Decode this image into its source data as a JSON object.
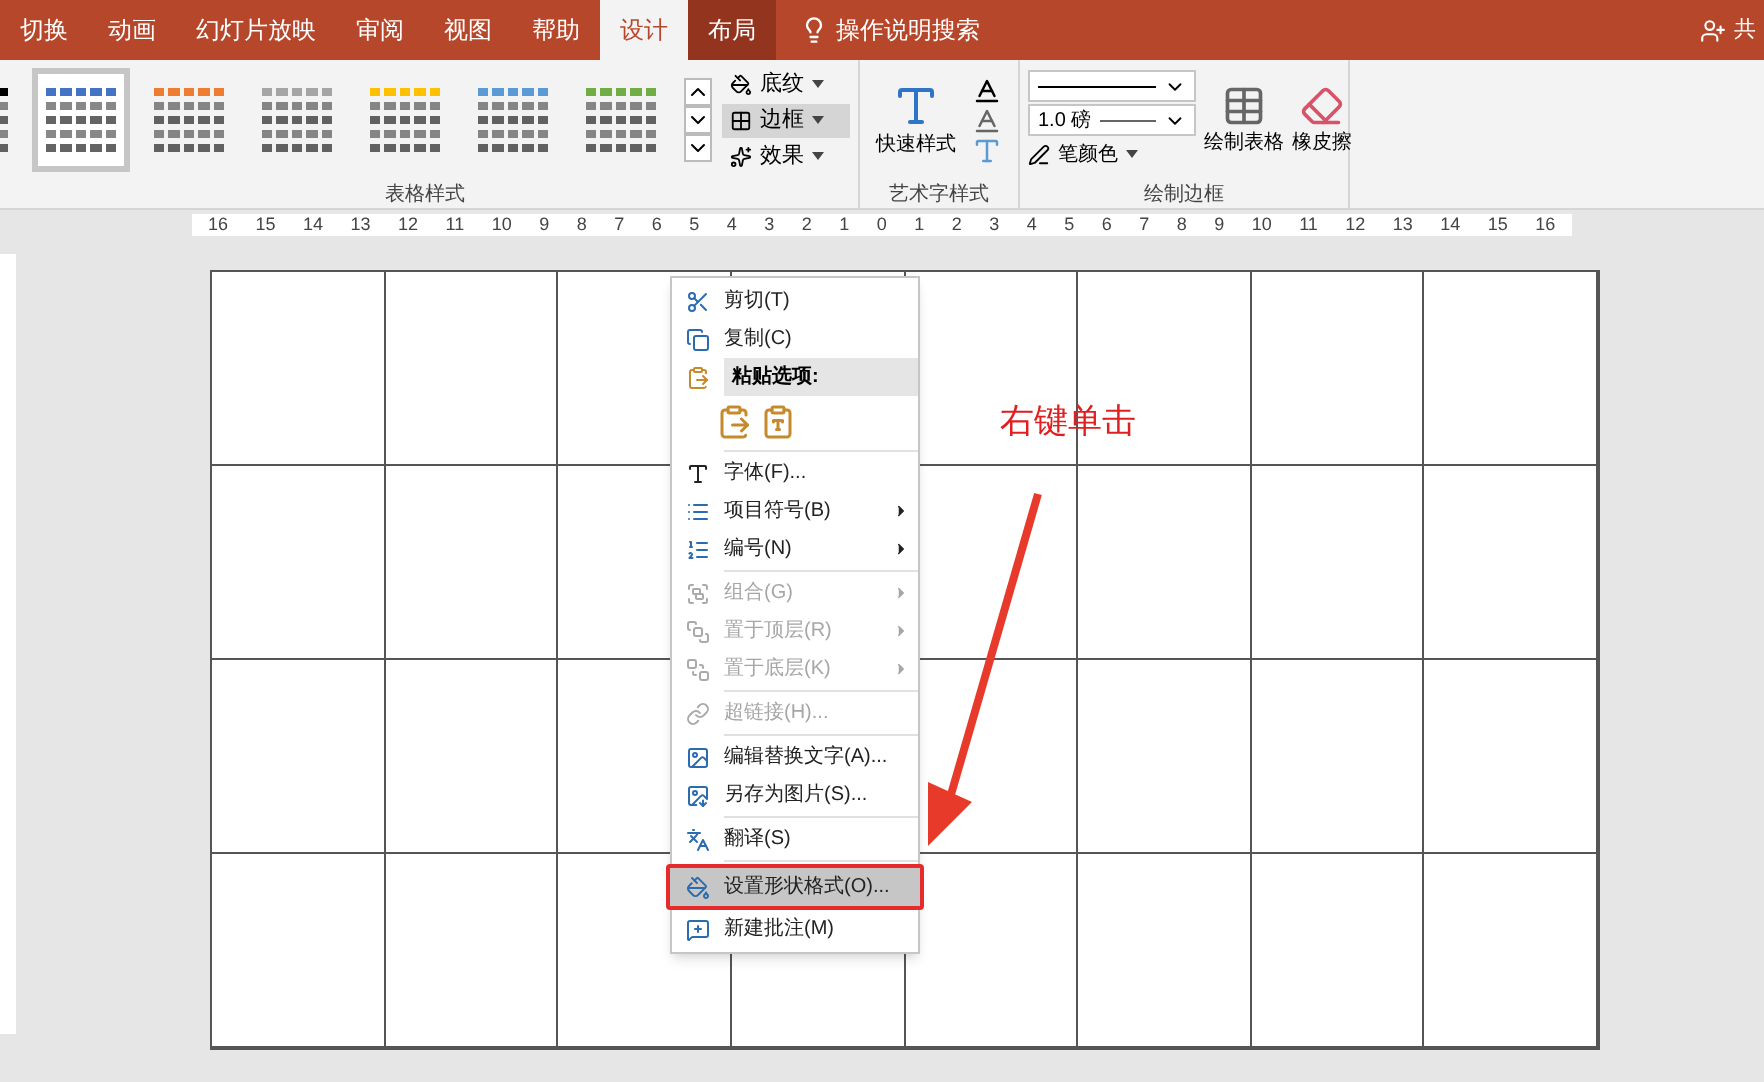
{
  "tabs": [
    {
      "label": "切换",
      "selected": false,
      "contextual": false
    },
    {
      "label": "动画",
      "selected": false,
      "contextual": false
    },
    {
      "label": "幻灯片放映",
      "selected": false,
      "contextual": false
    },
    {
      "label": "审阅",
      "selected": false,
      "contextual": false
    },
    {
      "label": "视图",
      "selected": false,
      "contextual": false
    },
    {
      "label": "帮助",
      "selected": false,
      "contextual": false
    },
    {
      "label": "设计",
      "selected": true,
      "contextual": true
    },
    {
      "label": "布局",
      "selected": false,
      "contextual": true
    }
  ],
  "tell_me": {
    "placeholder": "操作说明搜索"
  },
  "share": {
    "label": "共"
  },
  "ribbon": {
    "table_styles": {
      "label": "表格样式",
      "swatches": [
        {
          "color": "#000000",
          "selected": false
        },
        {
          "color": "#4472c4",
          "selected": true
        },
        {
          "color": "#ed7d31",
          "selected": false
        },
        {
          "color": "#a5a5a5",
          "selected": false
        },
        {
          "color": "#ffc000",
          "selected": false
        },
        {
          "color": "#5b9bd5",
          "selected": false
        },
        {
          "color": "#70ad47",
          "selected": false
        }
      ],
      "buttons": [
        {
          "label": "底纹",
          "selected": false
        },
        {
          "label": "边框",
          "selected": true
        },
        {
          "label": "效果",
          "selected": false
        }
      ]
    },
    "wordart": {
      "label": "艺术字样式",
      "quick_styles": "快速样式"
    },
    "draw_borders": {
      "label": "绘制边框",
      "pen_weight": "1.0 磅",
      "pen_color": "笔颜色",
      "draw_table": "绘制表格",
      "eraser": "橡皮擦"
    }
  },
  "ruler": [
    "16",
    "15",
    "14",
    "13",
    "12",
    "11",
    "10",
    "9",
    "8",
    "7",
    "6",
    "5",
    "4",
    "3",
    "2",
    "1",
    "0",
    "1",
    "2",
    "3",
    "4",
    "5",
    "6",
    "7",
    "8",
    "9",
    "10",
    "11",
    "12",
    "13",
    "14",
    "15",
    "16"
  ],
  "context_menu": [
    {
      "kind": "item",
      "label": "剪切(T)",
      "disabled": false,
      "submenu": false,
      "selected": false
    },
    {
      "kind": "item",
      "label": "复制(C)",
      "disabled": false,
      "submenu": false,
      "selected": false
    },
    {
      "kind": "header",
      "label": "粘贴选项:"
    },
    {
      "kind": "paste"
    },
    {
      "kind": "separator"
    },
    {
      "kind": "item",
      "label": "字体(F)...",
      "disabled": false,
      "submenu": false,
      "selected": false
    },
    {
      "kind": "item",
      "label": "项目符号(B)",
      "disabled": false,
      "submenu": true,
      "selected": false
    },
    {
      "kind": "item",
      "label": "编号(N)",
      "disabled": false,
      "submenu": true,
      "selected": false
    },
    {
      "kind": "separator"
    },
    {
      "kind": "item",
      "label": "组合(G)",
      "disabled": true,
      "submenu": true,
      "selected": false
    },
    {
      "kind": "item",
      "label": "置于顶层(R)",
      "disabled": true,
      "submenu": true,
      "selected": false
    },
    {
      "kind": "item",
      "label": "置于底层(K)",
      "disabled": true,
      "submenu": true,
      "selected": false
    },
    {
      "kind": "separator"
    },
    {
      "kind": "item",
      "label": "超链接(H)...",
      "disabled": true,
      "submenu": false,
      "selected": false
    },
    {
      "kind": "separator"
    },
    {
      "kind": "item",
      "label": "编辑替换文字(A)...",
      "disabled": false,
      "submenu": false,
      "selected": false
    },
    {
      "kind": "item",
      "label": "另存为图片(S)...",
      "disabled": false,
      "submenu": false,
      "selected": false
    },
    {
      "kind": "separator"
    },
    {
      "kind": "item",
      "label": "翻译(S)",
      "disabled": false,
      "submenu": false,
      "selected": false
    },
    {
      "kind": "separator"
    },
    {
      "kind": "item",
      "label": "设置形状格式(O)...",
      "disabled": false,
      "submenu": false,
      "selected": true
    },
    {
      "kind": "item",
      "label": "新建批注(M)",
      "disabled": false,
      "submenu": false,
      "selected": false
    }
  ],
  "annotation": {
    "text": "右键单击"
  }
}
